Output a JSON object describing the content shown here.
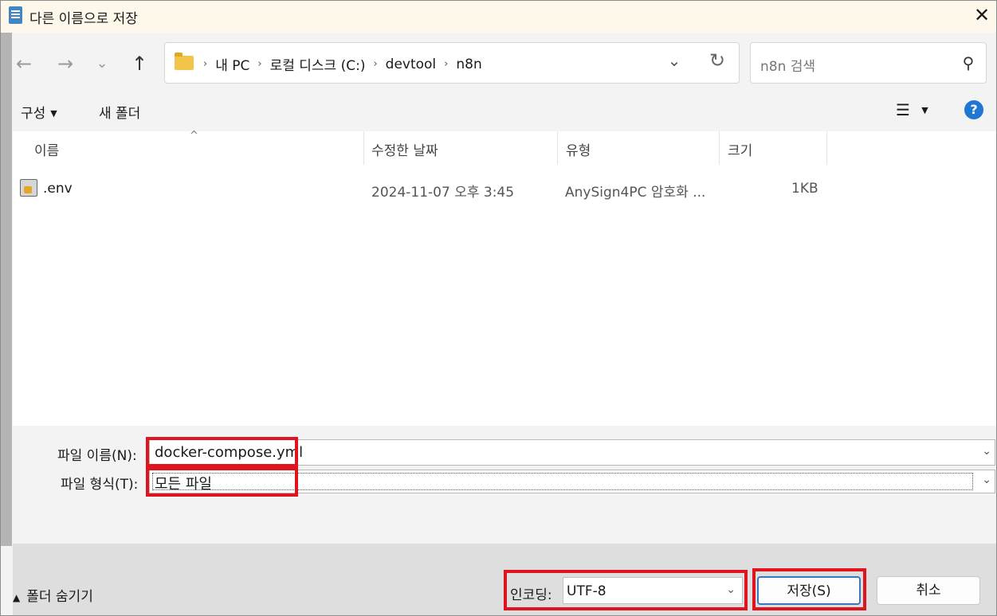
{
  "window": {
    "title": "다른 이름으로 저장",
    "close_label": "✕"
  },
  "nav": {
    "back_icon": "arrow-left-icon",
    "forward_icon": "arrow-right-icon",
    "recent_icon": "chevron-down-icon",
    "up_icon": "arrow-up-icon",
    "breadcrumbs": [
      "내 PC",
      "로컬 디스크 (C:)",
      "devtool",
      "n8n"
    ],
    "search_placeholder": "n8n 검색"
  },
  "toolbar": {
    "organize_label": "구성",
    "new_folder_label": "새 폴더",
    "help_label": "?"
  },
  "file_list": {
    "columns": [
      "이름",
      "수정한 날짜",
      "유형",
      "크기"
    ],
    "rows": [
      {
        "name": ".env",
        "modified": "2024-11-07 오후 3:45",
        "type": "AnySign4PC 암호화 ...",
        "size": "1KB"
      }
    ]
  },
  "form": {
    "file_name_label": "파일 이름(N):",
    "file_name_value": "docker-compose.yml",
    "file_type_label": "파일 형식(T):",
    "file_type_value": "모든 파일"
  },
  "footer": {
    "hide_folders_label": "폴더 숨기기",
    "encoding_label": "인코딩:",
    "encoding_value": "UTF-8",
    "save_label": "저장(S)",
    "cancel_label": "취소"
  },
  "colors": {
    "highlight": "#e0141e",
    "accent": "#1e77d3"
  }
}
